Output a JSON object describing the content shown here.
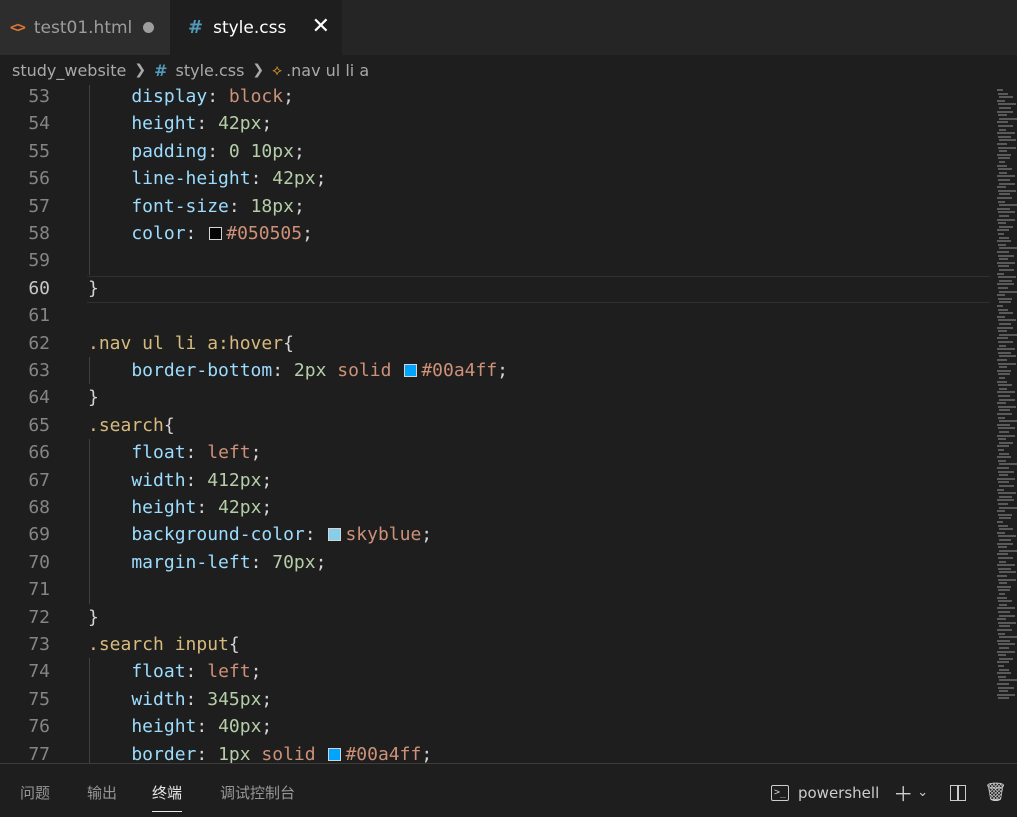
{
  "tabs": [
    {
      "label": "test01.html",
      "icon": "html-icon",
      "modified": true
    },
    {
      "label": "style.css",
      "icon": "css-icon",
      "active": true
    }
  ],
  "breadcrumb": {
    "folder": "study_website",
    "file": "style.css",
    "symbol": ".nav ul li a"
  },
  "editor": {
    "active_line": "60",
    "lines": [
      {
        "n": "53",
        "tokens": [
          [
            "prop",
            "    display"
          ],
          [
            "pun",
            ": "
          ],
          [
            "val",
            "block"
          ],
          [
            "pun",
            ";"
          ]
        ]
      },
      {
        "n": "54",
        "tokens": [
          [
            "prop",
            "    height"
          ],
          [
            "pun",
            ": "
          ],
          [
            "num",
            "42px"
          ],
          [
            "pun",
            ";"
          ]
        ]
      },
      {
        "n": "55",
        "tokens": [
          [
            "prop",
            "    padding"
          ],
          [
            "pun",
            ": "
          ],
          [
            "num",
            "0 10px"
          ],
          [
            "pun",
            ";"
          ]
        ]
      },
      {
        "n": "56",
        "tokens": [
          [
            "prop",
            "    line-height"
          ],
          [
            "pun",
            ": "
          ],
          [
            "num",
            "42px"
          ],
          [
            "pun",
            ";"
          ]
        ]
      },
      {
        "n": "57",
        "tokens": [
          [
            "prop",
            "    font-size"
          ],
          [
            "pun",
            ": "
          ],
          [
            "num",
            "18px"
          ],
          [
            "pun",
            ";"
          ]
        ]
      },
      {
        "n": "58",
        "tokens": [
          [
            "prop",
            "    color"
          ],
          [
            "pun",
            ": "
          ],
          [
            "swatch",
            "#050505"
          ],
          [
            "val",
            "#050505"
          ],
          [
            "pun",
            ";"
          ]
        ]
      },
      {
        "n": "59",
        "tokens": []
      },
      {
        "n": "60",
        "tokens": [
          [
            "pun",
            "}"
          ]
        ]
      },
      {
        "n": "61",
        "tokens": []
      },
      {
        "n": "62",
        "tokens": [
          [
            "sel",
            ".nav ul li a:hover"
          ],
          [
            "pun",
            "{"
          ]
        ]
      },
      {
        "n": "63",
        "tokens": [
          [
            "prop",
            "    border-bottom"
          ],
          [
            "pun",
            ": "
          ],
          [
            "num",
            "2px "
          ],
          [
            "val",
            "solid "
          ],
          [
            "swatch",
            "#00a4ff"
          ],
          [
            "val",
            "#00a4ff"
          ],
          [
            "pun",
            ";"
          ]
        ]
      },
      {
        "n": "64",
        "tokens": [
          [
            "pun",
            "}"
          ]
        ]
      },
      {
        "n": "65",
        "tokens": [
          [
            "sel",
            ".search"
          ],
          [
            "pun",
            "{"
          ]
        ]
      },
      {
        "n": "66",
        "tokens": [
          [
            "prop",
            "    float"
          ],
          [
            "pun",
            ": "
          ],
          [
            "val",
            "left"
          ],
          [
            "pun",
            ";"
          ]
        ]
      },
      {
        "n": "67",
        "tokens": [
          [
            "prop",
            "    width"
          ],
          [
            "pun",
            ": "
          ],
          [
            "num",
            "412px"
          ],
          [
            "pun",
            ";"
          ]
        ]
      },
      {
        "n": "68",
        "tokens": [
          [
            "prop",
            "    height"
          ],
          [
            "pun",
            ": "
          ],
          [
            "num",
            "42px"
          ],
          [
            "pun",
            ";"
          ]
        ]
      },
      {
        "n": "69",
        "tokens": [
          [
            "prop",
            "    background-color"
          ],
          [
            "pun",
            ": "
          ],
          [
            "swatch",
            "#87ceeb"
          ],
          [
            "val",
            "skyblue"
          ],
          [
            "pun",
            ";"
          ]
        ]
      },
      {
        "n": "70",
        "tokens": [
          [
            "prop",
            "    margin-left"
          ],
          [
            "pun",
            ": "
          ],
          [
            "num",
            "70px"
          ],
          [
            "pun",
            ";"
          ]
        ]
      },
      {
        "n": "71",
        "tokens": []
      },
      {
        "n": "72",
        "tokens": [
          [
            "pun",
            "}"
          ]
        ]
      },
      {
        "n": "73",
        "tokens": [
          [
            "sel",
            ".search input"
          ],
          [
            "pun",
            "{"
          ]
        ]
      },
      {
        "n": "74",
        "tokens": [
          [
            "prop",
            "    float"
          ],
          [
            "pun",
            ": "
          ],
          [
            "val",
            "left"
          ],
          [
            "pun",
            ";"
          ]
        ]
      },
      {
        "n": "75",
        "tokens": [
          [
            "prop",
            "    width"
          ],
          [
            "pun",
            ": "
          ],
          [
            "num",
            "345px"
          ],
          [
            "pun",
            ";"
          ]
        ]
      },
      {
        "n": "76",
        "tokens": [
          [
            "prop",
            "    height"
          ],
          [
            "pun",
            ": "
          ],
          [
            "num",
            "40px"
          ],
          [
            "pun",
            ";"
          ]
        ]
      },
      {
        "n": "77",
        "tokens": [
          [
            "prop",
            "    border"
          ],
          [
            "pun",
            ": "
          ],
          [
            "num",
            "1px "
          ],
          [
            "val",
            "solid "
          ],
          [
            "swatch",
            "#00a4ff"
          ],
          [
            "val",
            "#00a4ff"
          ],
          [
            "pun",
            ";"
          ]
        ]
      }
    ]
  },
  "panel": {
    "tabs": [
      "问题",
      "输出",
      "终端",
      "调试控制台"
    ],
    "active_tab": "终端",
    "terminal_name": "powershell"
  },
  "colors": {
    "background": "#1e1e1e",
    "selector": "#d7ba7d",
    "property": "#9cdcfe",
    "value": "#ce9178",
    "number": "#b5cea8"
  }
}
